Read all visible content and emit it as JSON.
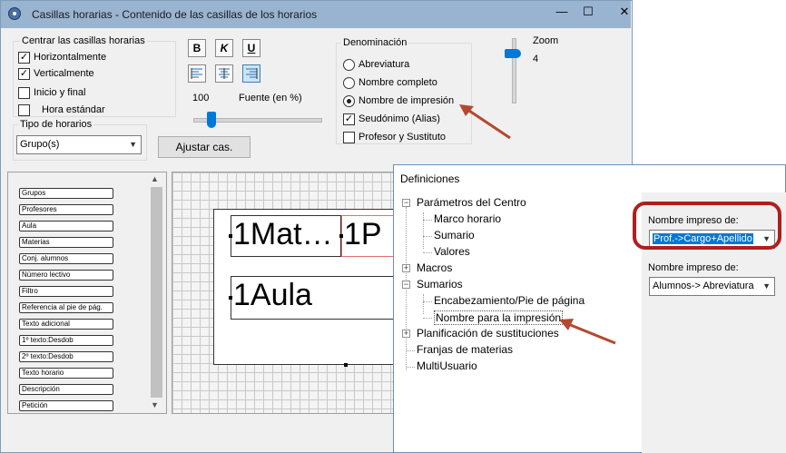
{
  "window": {
    "title": "Casillas horarias - Contenido de las casillas de los horarios",
    "minimize": "—",
    "maximize": "☐",
    "close": "✕"
  },
  "alignment": {
    "group_label": "Centrar las casillas horarias",
    "horizontal": {
      "label": "Horizontalmente",
      "checked": true
    },
    "vertical": {
      "label": "Verticalmente",
      "checked": true
    },
    "start_end": {
      "label": "Inicio y final",
      "checked": false
    },
    "standard_time": {
      "label": "Hora estándar",
      "checked": false
    }
  },
  "timetable_type": {
    "label": "Tipo de horarios",
    "selected": "Grupo(s)"
  },
  "format": {
    "bold": "B",
    "italic": "K",
    "underline": "U",
    "font_value": "100",
    "font_label": "Fuente (en %)",
    "adjust_button": "Ajustar cas."
  },
  "denomination": {
    "label": "Denominación",
    "options": [
      {
        "label": "Abreviatura",
        "selected": false
      },
      {
        "label": "Nombre completo",
        "selected": false
      },
      {
        "label": "Nombre de impresión",
        "selected": true
      }
    ],
    "pseudonym": {
      "label": "Seudónimo (Alias)",
      "checked": true
    },
    "teacher_substitute": {
      "label": "Profesor y Sustituto",
      "checked": false
    }
  },
  "zoom": {
    "label": "Zoom",
    "value": "4"
  },
  "fields": [
    "Grupos",
    "Profesores",
    "Aula",
    "Materias",
    "Conj. alumnos",
    "Número lectivo",
    "Filtro",
    "Referencia al pie de pág.",
    "Texto adicional",
    "1º texto:Desdob",
    "2º texto:Desdob",
    "Texto horario",
    "Descripción",
    "Petición"
  ],
  "preview": {
    "cell1": "1Mat…",
    "cell2": "1P",
    "cell3": "1Aula"
  },
  "definitions": {
    "title": "Definiciones",
    "tree": [
      {
        "label": "Parámetros del Centro",
        "level": 0,
        "expander": "−"
      },
      {
        "label": "Marco horario",
        "level": 1
      },
      {
        "label": "Sumario",
        "level": 1
      },
      {
        "label": "Valores",
        "level": 1
      },
      {
        "label": "Macros",
        "level": 0,
        "expander": "+"
      },
      {
        "label": "Sumarios",
        "level": 0,
        "expander": "−"
      },
      {
        "label": "Encabezamiento/Pie de página",
        "level": 1
      },
      {
        "label": "Nombre para la impresión",
        "level": 1,
        "selected": true
      },
      {
        "label": "Planificación de sustituciones",
        "level": 0,
        "expander": "+"
      },
      {
        "label": "Franjas de materias",
        "level": 0
      },
      {
        "label": "MultiUsuario",
        "level": 0
      }
    ],
    "print_name_label_1": "Nombre impreso de:",
    "print_name_value_1": "Prof.->Cargo+Apellido",
    "print_name_label_2": "Nombre impreso de:",
    "print_name_value_2": "Alumnos-> Abreviatura"
  },
  "colors": {
    "accent": "#0078d7",
    "annotation_red": "#b01e1e",
    "titlebar": "#99b4d1"
  }
}
